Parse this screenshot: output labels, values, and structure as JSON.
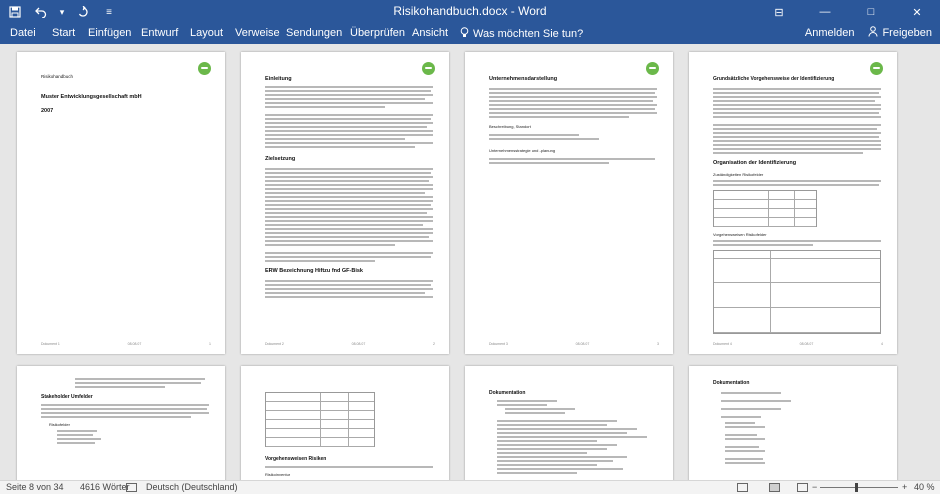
{
  "window": {
    "title": "Risikohandbuch.docx - Word",
    "controls": {
      "ribbon_display": "⊟",
      "minimize": "—",
      "maximize": "□",
      "close": "✕"
    }
  },
  "quick_access": {
    "save_icon": "save-icon",
    "undo_icon": "undo-icon",
    "undo_dropdown": "▾",
    "redo_icon": "redo-icon",
    "customize": "≡"
  },
  "ribbon": {
    "tabs": [
      "Datei",
      "Start",
      "Einfügen",
      "Entwurf",
      "Layout",
      "Verweise",
      "Sendungen",
      "Überprüfen",
      "Ansicht"
    ],
    "tell_me": "Was möchten Sie tun?",
    "sign_in": "Anmelden",
    "share": "Freigeben"
  },
  "pages": {
    "p1": {
      "heading_small": "Risikohandbuch",
      "heading": "Muster Entwicklungsgesellschaft mbH",
      "year": "2007",
      "footer_left": "Dokument 1",
      "footer_mid": "08.08.07",
      "footer_right": "1"
    },
    "p2": {
      "heading1": "Einleitung",
      "heading2": "Zielsetzung",
      "heading3": "ERW Bezeichnung Hiftzu fnd GF-Bisk",
      "footer_left": "Dokument 2",
      "footer_mid": "08.08.07",
      "footer_right": "2"
    },
    "p3": {
      "heading1": "Unternehmensdarstellung",
      "label1": "Beschreibung, Standort",
      "label2": "Unternehmensstrategie und -planung",
      "footer_left": "Dokument 3",
      "footer_mid": "08.08.07",
      "footer_right": "3"
    },
    "p4": {
      "heading1": "Grundsätzliche Vorgehensweise der Identifizierung",
      "heading2": "Organisation der Identifizierung",
      "label1": "Zuständigkeiten Risikofelder",
      "label2": "Vorgehensweisen Risikofelder",
      "footer_left": "Dokument 4",
      "footer_mid": "08.08.07",
      "footer_right": "4"
    },
    "p5": {
      "heading1": "Stakeholder Umfelder",
      "label1": "Risikofelder"
    },
    "p6": {
      "heading1": "Vorgehensweisen Risiken",
      "label1": "Risikoinventur"
    },
    "p7": {
      "heading1": "Dokumentation"
    },
    "p8": {
      "heading1": "Dokumentation"
    }
  },
  "status": {
    "page": "Seite 8 von 34",
    "words": "4616 Wörter",
    "language": "Deutsch (Deutschland)",
    "zoom": "40 %",
    "zoom_out": "−",
    "zoom_in": "+"
  }
}
